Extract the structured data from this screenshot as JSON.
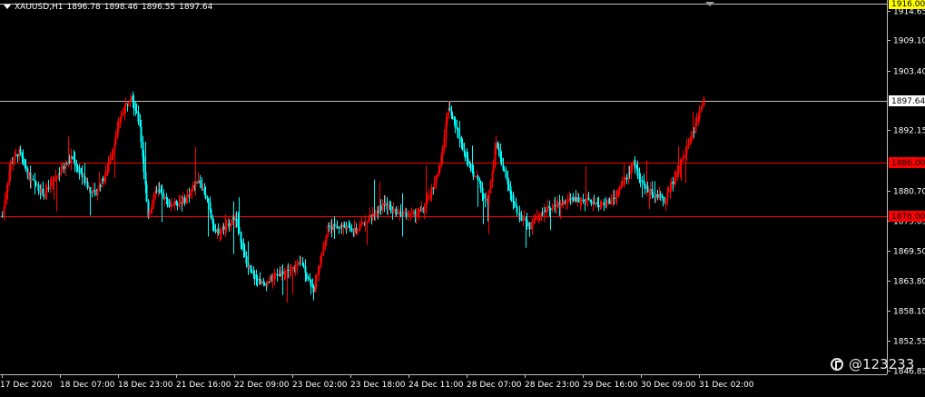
{
  "header": {
    "symbol": "XAUUSD,H1",
    "open": "1896.78",
    "high": "1898.46",
    "low": "1896.55",
    "close": "1897.64"
  },
  "watermark": {
    "text": "@123233"
  },
  "colors": {
    "background": "#000000",
    "bull": "#ff0000",
    "bear": "#00ffff",
    "grid_axis": "#c0c0c0",
    "level_line": "#ff0000",
    "price_line": "#c0c0c0"
  },
  "chart_data": {
    "type": "candlestick",
    "symbol": "XAUUSD",
    "timeframe": "H1",
    "ylim": [
      1846.85,
      1916.0
    ],
    "y_ticks": [
      "1914.65",
      "1909.10",
      "1903.40",
      "1892.15",
      "1880.70",
      "1875.05",
      "1869.50",
      "1863.80",
      "1858.10",
      "1852.55",
      "1846.85"
    ],
    "x_ticks": [
      "17 Dec 2020",
      "18 Dec 07:00",
      "18 Dec 23:00",
      "21 Dec 16:00",
      "22 Dec 09:00",
      "23 Dec 02:00",
      "23 Dec 18:00",
      "24 Dec 11:00",
      "28 Dec 07:00",
      "28 Dec 23:00",
      "29 Dec 16:00",
      "30 Dec 09:00",
      "31 Dec 02:00"
    ],
    "price_labels": [
      {
        "label": "1916.00",
        "value": 1916.0,
        "style": "highlight"
      },
      {
        "label": "1897.64",
        "value": 1897.64,
        "style": "current"
      },
      {
        "label": "1886.00",
        "value": 1886.0,
        "style": "level"
      },
      {
        "label": "1876.00",
        "value": 1876.0,
        "style": "level"
      }
    ],
    "horizontal_levels": [
      1916.0,
      1897.64,
      1886.0,
      1876.0
    ],
    "trend_path": [
      [
        0,
        1876
      ],
      [
        6,
        1886
      ],
      [
        12,
        1888
      ],
      [
        20,
        1883
      ],
      [
        30,
        1880
      ],
      [
        40,
        1884
      ],
      [
        50,
        1887
      ],
      [
        60,
        1882
      ],
      [
        66,
        1880
      ],
      [
        74,
        1884
      ],
      [
        86,
        1896
      ],
      [
        92,
        1899
      ],
      [
        98,
        1893
      ],
      [
        104,
        1876
      ],
      [
        110,
        1881
      ],
      [
        120,
        1878
      ],
      [
        130,
        1879
      ],
      [
        140,
        1883
      ],
      [
        146,
        1879
      ],
      [
        152,
        1873
      ],
      [
        160,
        1874
      ],
      [
        166,
        1876
      ],
      [
        174,
        1867
      ],
      [
        186,
        1863
      ],
      [
        196,
        1865
      ],
      [
        206,
        1866
      ],
      [
        214,
        1867
      ],
      [
        222,
        1862
      ],
      [
        232,
        1874
      ],
      [
        244,
        1874
      ],
      [
        252,
        1873
      ],
      [
        262,
        1876
      ],
      [
        272,
        1878
      ],
      [
        280,
        1877
      ],
      [
        290,
        1876
      ],
      [
        300,
        1877
      ],
      [
        312,
        1885
      ],
      [
        318,
        1897
      ],
      [
        324,
        1892
      ],
      [
        332,
        1886
      ],
      [
        340,
        1882
      ],
      [
        346,
        1878
      ],
      [
        352,
        1890
      ],
      [
        360,
        1882
      ],
      [
        368,
        1876
      ],
      [
        376,
        1874
      ],
      [
        386,
        1877
      ],
      [
        396,
        1878
      ],
      [
        406,
        1879
      ],
      [
        416,
        1879
      ],
      [
        426,
        1878
      ],
      [
        436,
        1879
      ],
      [
        444,
        1883
      ],
      [
        450,
        1886
      ],
      [
        456,
        1882
      ],
      [
        464,
        1880
      ],
      [
        472,
        1879
      ],
      [
        482,
        1885
      ],
      [
        490,
        1890
      ],
      [
        500,
        1897.64
      ]
    ]
  }
}
